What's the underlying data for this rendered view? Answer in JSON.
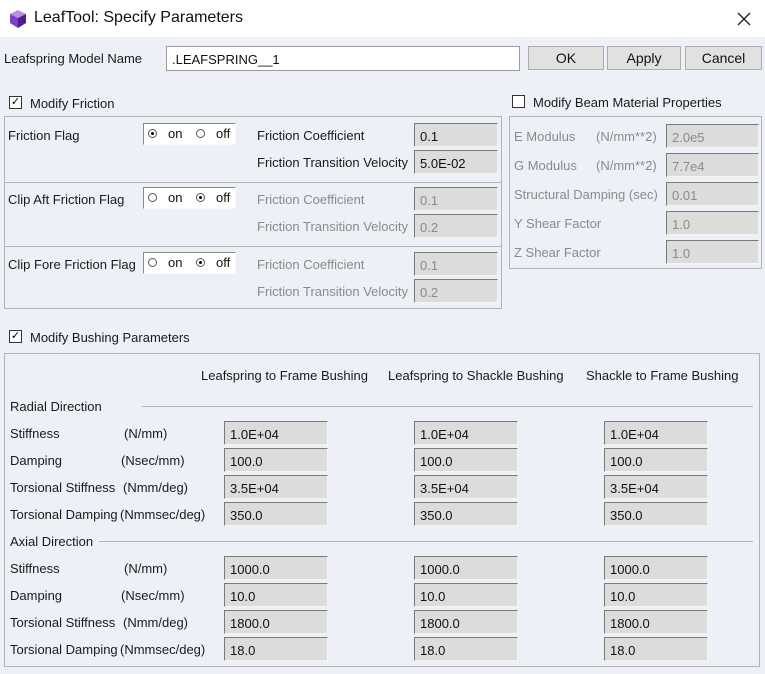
{
  "window": {
    "title": "LeafTool: Specify Parameters"
  },
  "model": {
    "label": "Leafspring Model Name",
    "value": ".LEAFSPRING__1"
  },
  "buttons": {
    "ok": "OK",
    "apply": "Apply",
    "cancel": "Cancel"
  },
  "friction": {
    "checkbox_label": "Modify Friction",
    "checked": true,
    "on_label": "on",
    "off_label": "off",
    "coef_label": "Friction Coefficient",
    "vel_label": "Friction Transition Velocity",
    "rows": [
      {
        "label": "Friction Flag",
        "selected": "on",
        "coef": "0.1",
        "vel": "5.0E-02"
      },
      {
        "label": "Clip Aft Friction Flag",
        "selected": "off",
        "coef": "0.1",
        "vel": "0.2"
      },
      {
        "label": "Clip Fore Friction Flag",
        "selected": "off",
        "coef": "0.1",
        "vel": "0.2"
      }
    ]
  },
  "beam": {
    "checkbox_label": "Modify Beam Material Properties",
    "checked": false,
    "rows": [
      {
        "label": "E Modulus",
        "unit": "(N/mm**2)",
        "value": "2.0e5"
      },
      {
        "label": "G Modulus",
        "unit": "(N/mm**2)",
        "value": "7.7e4"
      },
      {
        "label": "Structural Damping (sec)",
        "unit": "",
        "value": "0.01"
      },
      {
        "label": "Y Shear Factor",
        "unit": "",
        "value": "1.0"
      },
      {
        "label": "Z Shear Factor",
        "unit": "",
        "value": "1.0"
      }
    ]
  },
  "bushing": {
    "checkbox_label": "Modify Bushing Parameters",
    "checked": true,
    "columns": [
      "Leafspring to Frame Bushing",
      "Leafspring to Shackle Bushing",
      "Shackle to Frame Bushing"
    ],
    "radial": {
      "title": "Radial Direction",
      "rows": [
        {
          "label": "Stiffness",
          "unit": "(N/mm)",
          "values": [
            "1.0E+04",
            "1.0E+04",
            "1.0E+04"
          ]
        },
        {
          "label": "Damping",
          "unit": "(Nsec/mm)",
          "values": [
            "100.0",
            "100.0",
            "100.0"
          ]
        },
        {
          "label": "Torsional Stiffness",
          "unit": "(Nmm/deg)",
          "values": [
            "3.5E+04",
            "3.5E+04",
            "3.5E+04"
          ]
        },
        {
          "label": "Torsional Damping",
          "unit": "(Nmmsec/deg)",
          "values": [
            "350.0",
            "350.0",
            "350.0"
          ]
        }
      ]
    },
    "axial": {
      "title": "Axial Direction",
      "rows": [
        {
          "label": "Stiffness",
          "unit": "(N/mm)",
          "values": [
            "1000.0",
            "1000.0",
            "1000.0"
          ]
        },
        {
          "label": "Damping",
          "unit": "(Nsec/mm)",
          "values": [
            "10.0",
            "10.0",
            "10.0"
          ]
        },
        {
          "label": "Torsional Stiffness",
          "unit": "(Nmm/deg)",
          "values": [
            "1800.0",
            "1800.0",
            "1800.0"
          ]
        },
        {
          "label": "Torsional Damping",
          "unit": "(Nmmsec/deg)",
          "values": [
            "18.0",
            "18.0",
            "18.0"
          ]
        }
      ]
    }
  },
  "colors": {
    "client_bg": "#eef0f7",
    "field_bg": "#dcdcdc",
    "disabled_text": "#8a8a8a",
    "button_bg": "#e1e1e1"
  },
  "icons": {
    "app": "purple-cube-icon",
    "close": "close-icon",
    "check": "check-mark-icon"
  }
}
